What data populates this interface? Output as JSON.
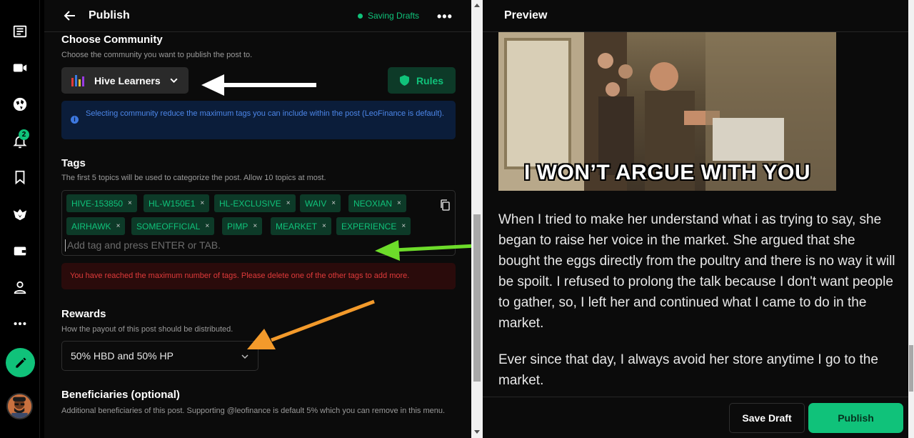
{
  "header": {
    "title": "Publish",
    "status": "Saving Drafts",
    "more": "•••"
  },
  "rail": {
    "notification_count": "2",
    "icons": [
      "newspaper-icon",
      "video-icon",
      "globe-icon",
      "bell-icon",
      "bookmark-icon",
      "leo-icon",
      "wallet-icon",
      "user-icon",
      "more-icon"
    ]
  },
  "community": {
    "title": "Choose Community",
    "subtitle": "Choose the community you want to publish the post to.",
    "selected": "Hive Learners",
    "rules_label": "Rules",
    "info": "Selecting community reduce the maximum tags you can include within the post (LeoFinance is default)."
  },
  "tags": {
    "title": "Tags",
    "subtitle": "The first 5 topics will be used to categorize the post. Allow 10 topics at most.",
    "items": [
      "HIVE-153850",
      "HL-W150E1",
      "HL-EXCLUSIVE",
      "WAIV",
      "NEOXIAN",
      "AIRHAWK",
      "SOMEOFFICIAL",
      "PIMP",
      "MEARKET",
      "EXPERIENCE"
    ],
    "remove_glyph": "×",
    "placeholder": "Add tag and press ENTER or TAB.",
    "error": "You have reached the maximum number of tags. Please delete one of the other tags to add more."
  },
  "rewards": {
    "title": "Rewards",
    "subtitle": "How the payout of this post should be distributed.",
    "selected": "50% HBD and 50% HP"
  },
  "beneficiaries": {
    "title": "Beneficiaries (optional)",
    "subtitle": "Additional beneficiaries of this post. Supporting @leofinance is default 5% which you can remove in this menu."
  },
  "preview": {
    "title": "Preview",
    "meme_caption": "I WON’T ARGUE WITH YOU",
    "paragraph1": "When I tried to make her understand what i as trying to say, she began to raise her voice in the market. She argued that she bought the eggs directly from the poultry and there is no way it will be spoilt. I refused to prolong the talk because I don't want people to gather, so, I left her and continued what I came to do in the market.",
    "paragraph2": "Ever since that day, I always avoid her store anytime I go to the market."
  },
  "footer": {
    "save_draft": "Save Draft",
    "publish": "Publish"
  },
  "colors": {
    "accent": "#10c27a",
    "error": "#e03a3a",
    "info": "#4c86e8"
  }
}
